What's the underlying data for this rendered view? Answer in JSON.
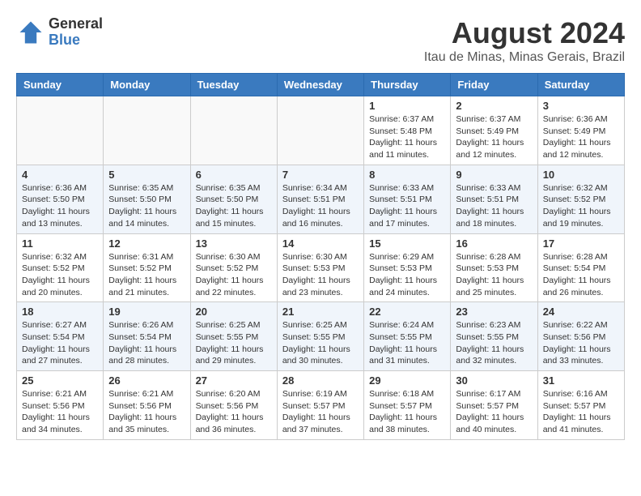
{
  "header": {
    "logo_line1": "General",
    "logo_line2": "Blue",
    "title": "August 2024",
    "subtitle": "Itau de Minas, Minas Gerais, Brazil"
  },
  "weekdays": [
    "Sunday",
    "Monday",
    "Tuesday",
    "Wednesday",
    "Thursday",
    "Friday",
    "Saturday"
  ],
  "weeks": [
    [
      {
        "day": "",
        "info": ""
      },
      {
        "day": "",
        "info": ""
      },
      {
        "day": "",
        "info": ""
      },
      {
        "day": "",
        "info": ""
      },
      {
        "day": "1",
        "info": "Sunrise: 6:37 AM\nSunset: 5:48 PM\nDaylight: 11 hours and 11 minutes."
      },
      {
        "day": "2",
        "info": "Sunrise: 6:37 AM\nSunset: 5:49 PM\nDaylight: 11 hours and 12 minutes."
      },
      {
        "day": "3",
        "info": "Sunrise: 6:36 AM\nSunset: 5:49 PM\nDaylight: 11 hours and 12 minutes."
      }
    ],
    [
      {
        "day": "4",
        "info": "Sunrise: 6:36 AM\nSunset: 5:50 PM\nDaylight: 11 hours and 13 minutes."
      },
      {
        "day": "5",
        "info": "Sunrise: 6:35 AM\nSunset: 5:50 PM\nDaylight: 11 hours and 14 minutes."
      },
      {
        "day": "6",
        "info": "Sunrise: 6:35 AM\nSunset: 5:50 PM\nDaylight: 11 hours and 15 minutes."
      },
      {
        "day": "7",
        "info": "Sunrise: 6:34 AM\nSunset: 5:51 PM\nDaylight: 11 hours and 16 minutes."
      },
      {
        "day": "8",
        "info": "Sunrise: 6:33 AM\nSunset: 5:51 PM\nDaylight: 11 hours and 17 minutes."
      },
      {
        "day": "9",
        "info": "Sunrise: 6:33 AM\nSunset: 5:51 PM\nDaylight: 11 hours and 18 minutes."
      },
      {
        "day": "10",
        "info": "Sunrise: 6:32 AM\nSunset: 5:52 PM\nDaylight: 11 hours and 19 minutes."
      }
    ],
    [
      {
        "day": "11",
        "info": "Sunrise: 6:32 AM\nSunset: 5:52 PM\nDaylight: 11 hours and 20 minutes."
      },
      {
        "day": "12",
        "info": "Sunrise: 6:31 AM\nSunset: 5:52 PM\nDaylight: 11 hours and 21 minutes."
      },
      {
        "day": "13",
        "info": "Sunrise: 6:30 AM\nSunset: 5:52 PM\nDaylight: 11 hours and 22 minutes."
      },
      {
        "day": "14",
        "info": "Sunrise: 6:30 AM\nSunset: 5:53 PM\nDaylight: 11 hours and 23 minutes."
      },
      {
        "day": "15",
        "info": "Sunrise: 6:29 AM\nSunset: 5:53 PM\nDaylight: 11 hours and 24 minutes."
      },
      {
        "day": "16",
        "info": "Sunrise: 6:28 AM\nSunset: 5:53 PM\nDaylight: 11 hours and 25 minutes."
      },
      {
        "day": "17",
        "info": "Sunrise: 6:28 AM\nSunset: 5:54 PM\nDaylight: 11 hours and 26 minutes."
      }
    ],
    [
      {
        "day": "18",
        "info": "Sunrise: 6:27 AM\nSunset: 5:54 PM\nDaylight: 11 hours and 27 minutes."
      },
      {
        "day": "19",
        "info": "Sunrise: 6:26 AM\nSunset: 5:54 PM\nDaylight: 11 hours and 28 minutes."
      },
      {
        "day": "20",
        "info": "Sunrise: 6:25 AM\nSunset: 5:55 PM\nDaylight: 11 hours and 29 minutes."
      },
      {
        "day": "21",
        "info": "Sunrise: 6:25 AM\nSunset: 5:55 PM\nDaylight: 11 hours and 30 minutes."
      },
      {
        "day": "22",
        "info": "Sunrise: 6:24 AM\nSunset: 5:55 PM\nDaylight: 11 hours and 31 minutes."
      },
      {
        "day": "23",
        "info": "Sunrise: 6:23 AM\nSunset: 5:55 PM\nDaylight: 11 hours and 32 minutes."
      },
      {
        "day": "24",
        "info": "Sunrise: 6:22 AM\nSunset: 5:56 PM\nDaylight: 11 hours and 33 minutes."
      }
    ],
    [
      {
        "day": "25",
        "info": "Sunrise: 6:21 AM\nSunset: 5:56 PM\nDaylight: 11 hours and 34 minutes."
      },
      {
        "day": "26",
        "info": "Sunrise: 6:21 AM\nSunset: 5:56 PM\nDaylight: 11 hours and 35 minutes."
      },
      {
        "day": "27",
        "info": "Sunrise: 6:20 AM\nSunset: 5:56 PM\nDaylight: 11 hours and 36 minutes."
      },
      {
        "day": "28",
        "info": "Sunrise: 6:19 AM\nSunset: 5:57 PM\nDaylight: 11 hours and 37 minutes."
      },
      {
        "day": "29",
        "info": "Sunrise: 6:18 AM\nSunset: 5:57 PM\nDaylight: 11 hours and 38 minutes."
      },
      {
        "day": "30",
        "info": "Sunrise: 6:17 AM\nSunset: 5:57 PM\nDaylight: 11 hours and 40 minutes."
      },
      {
        "day": "31",
        "info": "Sunrise: 6:16 AM\nSunset: 5:57 PM\nDaylight: 11 hours and 41 minutes."
      }
    ]
  ]
}
